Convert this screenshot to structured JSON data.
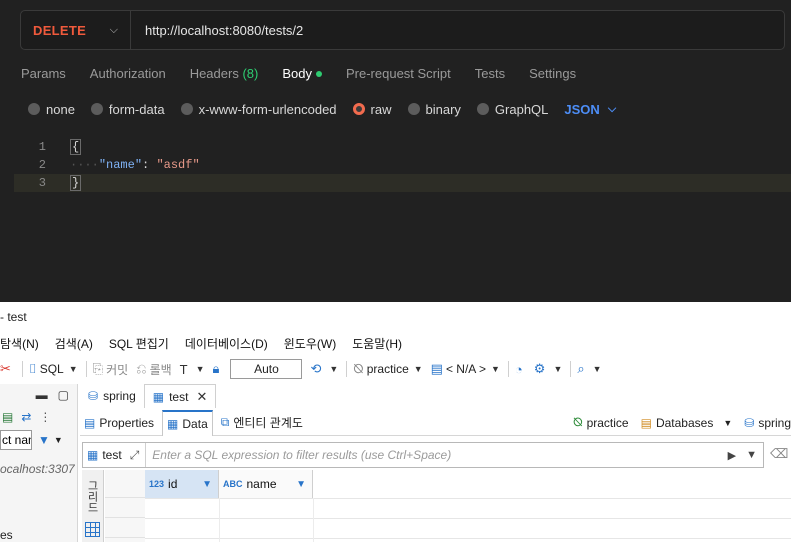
{
  "postman": {
    "method": "DELETE",
    "url": "http://localhost:8080/tests/2",
    "tabs": [
      {
        "label": "Params"
      },
      {
        "label": "Authorization"
      },
      {
        "label": "Headers",
        "count": "(8)"
      },
      {
        "label": "Body"
      },
      {
        "label": "Pre-request Script"
      },
      {
        "label": "Tests"
      },
      {
        "label": "Settings"
      }
    ],
    "body_options": [
      "none",
      "form-data",
      "x-www-form-urlencoded",
      "raw",
      "binary",
      "GraphQL"
    ],
    "selected_body_option": "raw",
    "format": "JSON",
    "editor": {
      "line_numbers": [
        "1",
        "2",
        "3"
      ],
      "open_brace": "{",
      "indent": "····",
      "key": "\"name\"",
      "colon": ": ",
      "value": "\"asdf\"",
      "close_brace": "}"
    },
    "colors": {
      "method": "#f05a3c",
      "active_dot": "#2ecc71",
      "format": "#4d8ef7"
    }
  },
  "dbeaver": {
    "window_title": "- test",
    "menu": [
      "탐색(N)",
      "검색(A)",
      "SQL 편집기",
      "데이터베이스(D)",
      "윈도우(W)",
      "도움말(H)"
    ],
    "toolbar": {
      "sql": "SQL",
      "commit": "커밋",
      "rollback": "롤백",
      "auto": "Auto",
      "schema": "practice",
      "na": "< N/A >"
    },
    "left_panel": {
      "filter_value": "ct nan",
      "connection": "ocalhost:3307",
      "bottom_label": "es"
    },
    "editor_tabs": [
      {
        "label": "spring",
        "active": false
      },
      {
        "label": "test",
        "active": true,
        "close": "✕"
      }
    ],
    "sub_tabs": [
      {
        "label": "Properties"
      },
      {
        "label": "Data"
      },
      {
        "label": "엔티티 관계도"
      }
    ],
    "right_info": {
      "schema": "practice",
      "databases": "Databases",
      "conn": "spring"
    },
    "filter": {
      "table": "test",
      "placeholder": "Enter a SQL expression to filter results (use Ctrl+Space)"
    },
    "grid": {
      "vertical_tab": "그리드",
      "columns": [
        {
          "type": "123",
          "name": "id"
        },
        {
          "type": "ABC",
          "name": "name"
        }
      ]
    }
  }
}
